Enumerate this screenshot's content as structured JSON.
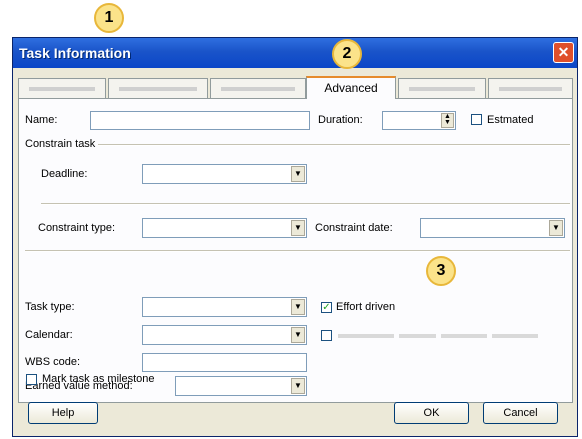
{
  "callouts": [
    "1",
    "2",
    "3"
  ],
  "window": {
    "title": "Task Information",
    "close_glyph": "✕"
  },
  "tabs": {
    "active_label": "Advanced"
  },
  "fields": {
    "name_label": "Name:",
    "duration_label": "Duration:",
    "estimated_label": "Estmated",
    "constrain_group_label": "Constrain task",
    "deadline_label": "Deadline:",
    "constraint_type_label": "Constraint type:",
    "constraint_date_label": "Constraint date:",
    "task_type_label": "Task type:",
    "effort_driven_label": "Effort driven",
    "calendar_label": "Calendar:",
    "wbs_label": "WBS code:",
    "earned_value_label": "Earned value method:",
    "milestone_label": "Mark task as milestone"
  },
  "state": {
    "estimated_checked": false,
    "effort_driven_checked": true,
    "calendar_ignore_checked": false,
    "milestone_checked": false
  },
  "buttons": {
    "help": "Help",
    "ok": "OK",
    "cancel": "Cancel"
  },
  "icons": {
    "dropdown": "chevron-down-icon",
    "spin": "spin-arrows-icon",
    "check": "checkmark-icon"
  },
  "colors": {
    "title_bar": "#0b46c8",
    "dialog_bg": "#ece9d8",
    "callout": "#fbe38a",
    "active_tab_accent": "#e68b2c"
  }
}
